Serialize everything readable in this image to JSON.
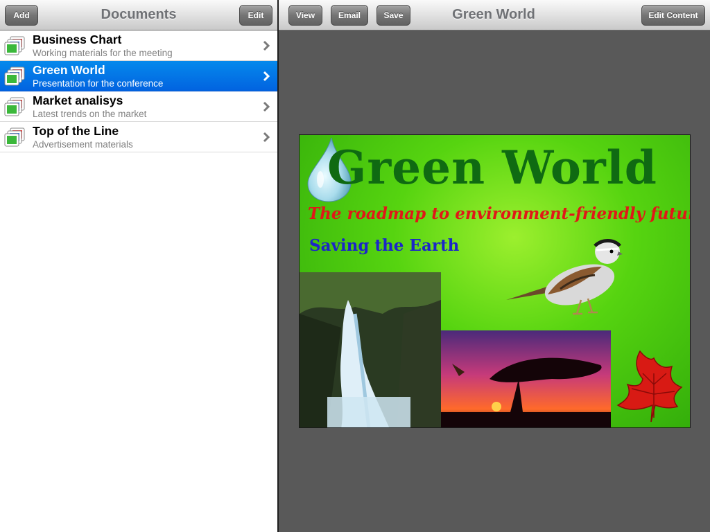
{
  "master": {
    "title": "Documents",
    "add_label": "Add",
    "edit_label": "Edit",
    "items": [
      {
        "title": "Business Chart",
        "subtitle": "Working materials for the meeting",
        "selected": false,
        "icon": "document-images-icon"
      },
      {
        "title": "Green World",
        "subtitle": "Presentation for the conference",
        "selected": true,
        "icon": "document-images-icon"
      },
      {
        "title": "Market analisys",
        "subtitle": "Latest trends on the market",
        "selected": false,
        "icon": "document-images-icon"
      },
      {
        "title": "Top of the Line",
        "subtitle": "Advertisement materials",
        "selected": false,
        "icon": "document-images-icon"
      }
    ]
  },
  "detail": {
    "title": "Green World",
    "view_label": "View",
    "email_label": "Email",
    "save_label": "Save",
    "edit_content_label": "Edit Content",
    "slide": {
      "title": "Green World",
      "subtitle": "The roadmap to environment-friendly future",
      "tagline": "Saving the Earth"
    }
  },
  "colors": {
    "selection": "#0263e0",
    "slide_title": "#0f6a12",
    "slide_subtitle": "#e01818",
    "slide_tagline": "#1c25c9"
  }
}
